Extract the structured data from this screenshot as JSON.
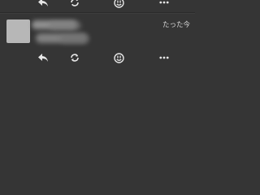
{
  "theme": {
    "background": "#353535",
    "icon_color": "#e6e6e6",
    "avatar_color": "#b7b7b7"
  },
  "previous_post": {
    "actions": [
      {
        "icon": "reply-icon"
      },
      {
        "icon": "retweet-icon"
      },
      {
        "icon": "reaction-icon"
      },
      {
        "icon": "more-icon"
      }
    ]
  },
  "post": {
    "timestamp": "たった今",
    "user_name_obscured": true,
    "text_obscured": true,
    "actions": [
      {
        "icon": "reply-icon"
      },
      {
        "icon": "retweet-icon"
      },
      {
        "icon": "reaction-icon"
      },
      {
        "icon": "more-icon"
      }
    ]
  }
}
